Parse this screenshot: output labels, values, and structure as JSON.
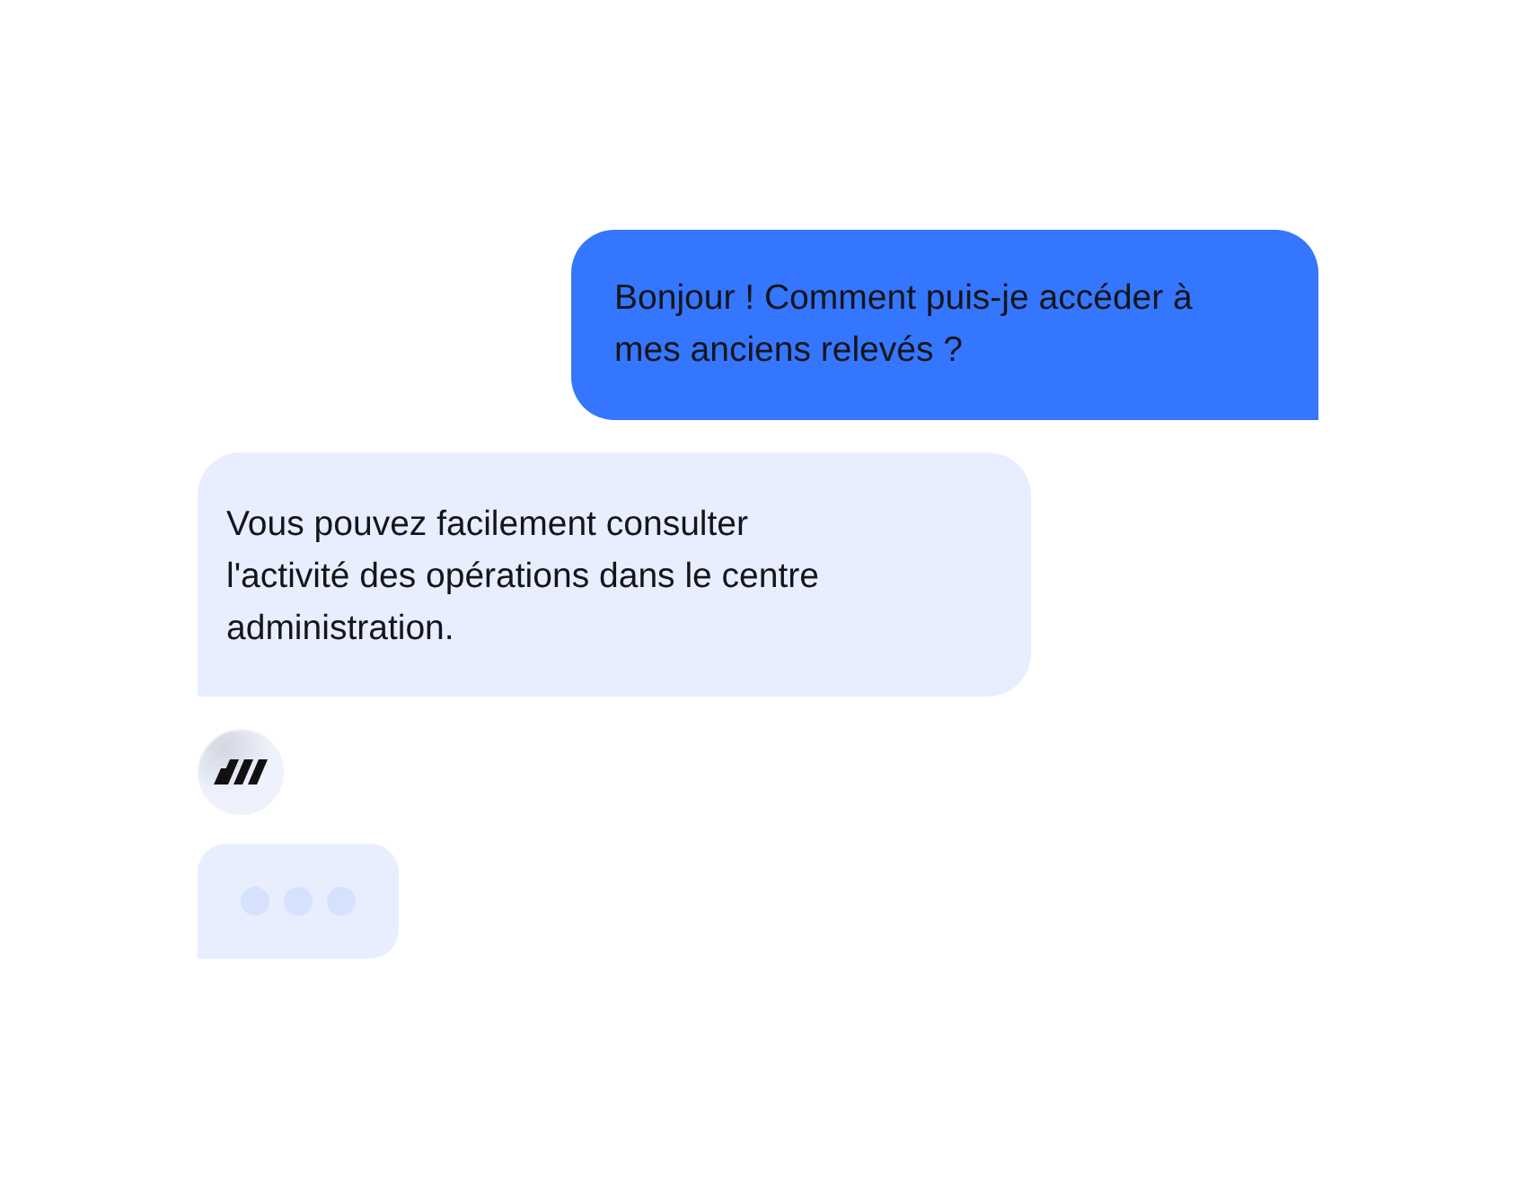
{
  "messages": [
    {
      "kind": "sent",
      "text": "Bonjour ! Comment puis-je accéder à mes anciens relevés ?"
    },
    {
      "kind": "received",
      "text": "Vous pouvez facilement consulter l'activité des opérations dans le centre administration."
    },
    {
      "kind": "avatar"
    },
    {
      "kind": "typing"
    }
  ]
}
